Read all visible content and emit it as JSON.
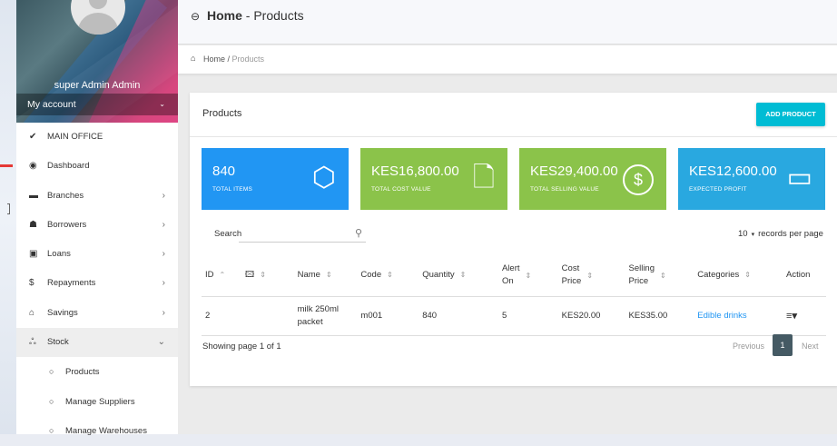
{
  "sidebar": {
    "user_name": "super Admin Admin",
    "account_label": "My account",
    "items": [
      {
        "icon": "check-icon",
        "glyph": "✔",
        "label": "MAIN OFFICE"
      },
      {
        "icon": "dashboard-icon",
        "glyph": "◉",
        "label": "Dashboard"
      },
      {
        "icon": "branches-icon",
        "glyph": "▬",
        "label": "Branches",
        "arrow": "›"
      },
      {
        "icon": "borrowers-icon",
        "glyph": "☗",
        "label": "Borrowers",
        "arrow": "›"
      },
      {
        "icon": "loans-icon",
        "glyph": "▣",
        "label": "Loans",
        "arrow": "›"
      },
      {
        "icon": "dollar-icon",
        "glyph": "$",
        "label": "Repayments",
        "arrow": "›"
      },
      {
        "icon": "bank-icon",
        "glyph": "⌂",
        "label": "Savings",
        "arrow": "›"
      },
      {
        "icon": "stock-icon",
        "glyph": "ஃ",
        "label": "Stock",
        "arrow": "⌄"
      }
    ],
    "sub_items": [
      {
        "icon": "circle-icon",
        "glyph": "○",
        "label": "Products"
      },
      {
        "icon": "circle-icon",
        "glyph": "○",
        "label": "Manage Suppliers"
      },
      {
        "icon": "circle-icon",
        "glyph": "○",
        "label": "Manage Warehouses"
      }
    ]
  },
  "topbar": {
    "back_glyph": "⊖",
    "title_bold": "Home",
    "title_rest": " - Products"
  },
  "breadcrumb": {
    "home_glyph": "⌂",
    "home": "Home",
    "sep": " / ",
    "current": "Products"
  },
  "card": {
    "title": "Products",
    "add_button": "ADD PRODUCT"
  },
  "stats": [
    {
      "value": "840",
      "label": "TOTAL ITEMS",
      "icon": "cube-icon",
      "glyph": "⬡"
    },
    {
      "value": "KES16,800.00",
      "label": "TOTAL COST VALUE",
      "icon": "file-icon",
      "glyph": "🗋"
    },
    {
      "value": "KES29,400.00",
      "label": "TOTAL SELLING VALUE",
      "icon": "dollar-circle-icon",
      "glyph": "$"
    },
    {
      "value": "KES12,600.00",
      "label": "EXPECTED PROFIT",
      "icon": "wallet-icon",
      "glyph": "▭"
    }
  ],
  "search": {
    "label": "Search",
    "icon_glyph": "⚲"
  },
  "records": {
    "value": "10",
    "caret": "▾",
    "label": "records per page"
  },
  "table": {
    "headers": {
      "id": "ID",
      "image": "🖾",
      "name": "Name",
      "code": "Code",
      "quantity": "Quantity",
      "alert_1": "Alert",
      "alert_2": "On",
      "cost_1": "Cost",
      "cost_2": "Price",
      "sell_1": "Selling",
      "sell_2": "Price",
      "categories": "Categories",
      "action": "Action"
    },
    "sort_glyph": "⇕",
    "sort_asc": "⌃",
    "rows": [
      {
        "id": "2",
        "name_1": "milk 250ml",
        "name_2": "packet",
        "code": "m001",
        "quantity": "840",
        "alert": "5",
        "cost": "KES20.00",
        "selling": "KES35.00",
        "category": "Edible drinks",
        "action_glyph": "≡▾"
      }
    ]
  },
  "footer": {
    "showing": "Showing page 1 of 1",
    "previous": "Previous",
    "page": "1",
    "next": "Next"
  }
}
